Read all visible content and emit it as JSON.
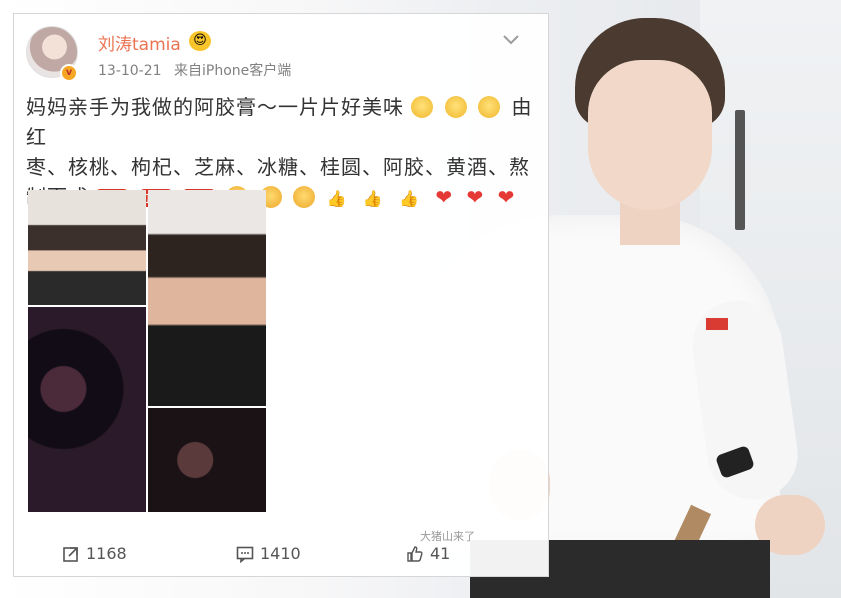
{
  "post": {
    "username": "刘涛tamia",
    "vip_badge": "😍",
    "verify_mark": "v",
    "date": "13-10-21",
    "source": "来自iPhone客户端",
    "text_line1": "妈妈亲手为我做的阿胶膏～一片片好美味",
    "text_line1_end": "由红",
    "text_line2": "枣、核桃、枸杞、芝麻、冰糖、桂圆、阿胶、黄酒、熬",
    "text_line3": "制而成",
    "jiayou_label": "加油"
  },
  "actions": {
    "repost_count": "1168",
    "comment_count": "1410",
    "like_count": "41"
  },
  "watermark": "大猪山来了",
  "icons": {
    "avatar": "avatar",
    "chevron": "chevron-down-icon",
    "repost": "repost-icon",
    "comment": "comment-icon",
    "like": "thumbs-up-icon"
  },
  "colors": {
    "username": "#eb7350",
    "text": "#333333",
    "meta": "#808080"
  }
}
